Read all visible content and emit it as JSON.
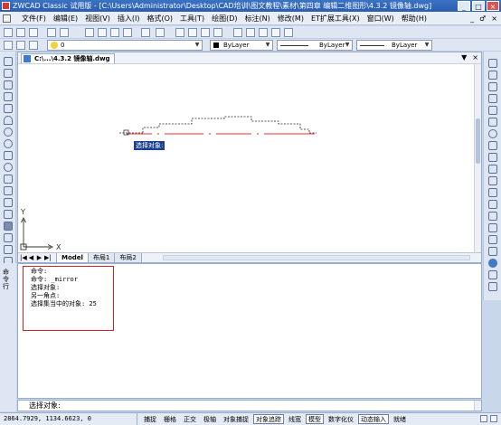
{
  "window": {
    "title": "ZWCAD Classic 试用版 - [C:\\Users\\Administrator\\Desktop\\CAD培训\\图文教程\\素材\\第四章 编辑二维图形\\4.3.2 镜像轴.dwg]",
    "minimize": "_",
    "maximize": "□",
    "close": "×"
  },
  "menu": {
    "items": [
      "文件(F)",
      "编辑(E)",
      "视图(V)",
      "插入(I)",
      "格式(O)",
      "工具(T)",
      "绘图(D)",
      "标注(N)",
      "修改(M)",
      "ET扩展工具(X)",
      "窗口(W)",
      "帮助(H)"
    ],
    "right_controls": [
      "_",
      "♂",
      "×"
    ]
  },
  "toolbar": {
    "layer_value": "0",
    "color_value": "ByLayer",
    "linetype_value": "ByLayer",
    "lineweight_value": "ByLayer"
  },
  "document": {
    "tab_label": "C:\\...\\4.3.2 镜像轴.dwg",
    "tab_controls": [
      "▼",
      "×"
    ],
    "selection_tooltip": "选择对象:",
    "axis_x": "X",
    "axis_y": "Y"
  },
  "layout_tabs": {
    "nav": [
      "|◀",
      "◀",
      "▶",
      "▶|"
    ],
    "tabs": [
      "Model",
      "布局1",
      "布局2"
    ]
  },
  "command": {
    "history": [
      "命令:",
      "命令: _mirror",
      "选择对象:",
      "另一角点:",
      "选择集当中的对象: 25"
    ],
    "prompt": "选择对象:",
    "side_caption": "命令行"
  },
  "statusbar": {
    "coords": "2864.7929, 1134.6623, 0",
    "toggles": [
      {
        "label": "捕捉",
        "on": false
      },
      {
        "label": "栅格",
        "on": false
      },
      {
        "label": "正交",
        "on": false
      },
      {
        "label": "极轴",
        "on": false
      },
      {
        "label": "对象捕捉",
        "on": false
      },
      {
        "label": "对象追踪",
        "on": true
      },
      {
        "label": "线宽",
        "on": false
      },
      {
        "label": "模型",
        "on": true
      },
      {
        "label": "数字化仪",
        "on": false
      },
      {
        "label": "动态输入",
        "on": true
      },
      {
        "label": "就绪",
        "on": false
      }
    ]
  },
  "colors": {
    "title_bar": "#2a5db0",
    "mirror_line": "#e53030",
    "selection_tooltip_bg": "#1a3f8f",
    "highlight_box": "#d02020"
  }
}
